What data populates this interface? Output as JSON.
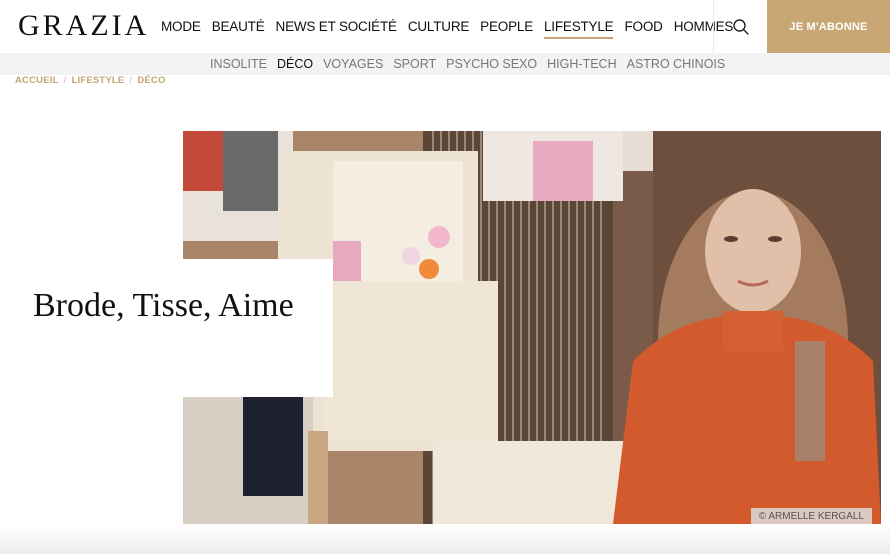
{
  "header": {
    "logo": "GRAZIA",
    "nav": [
      "MODE",
      "BEAUTÉ",
      "NEWS ET SOCIÉTÉ",
      "CULTURE",
      "PEOPLE",
      "LIFESTYLE",
      "FOOD",
      "HOMMES"
    ],
    "active_nav": "LIFESTYLE",
    "search_icon": "search-icon",
    "subscribe_label": "JE M'ABONNE",
    "accent_color": "#c9a775"
  },
  "subnav": {
    "items": [
      "INSOLITE",
      "DÉCO",
      "VOYAGES",
      "SPORT",
      "PSYCHO SEXO",
      "HIGH-TECH",
      "ASTRO CHINOIS"
    ],
    "active": "DÉCO"
  },
  "breadcrumb": [
    "ACCUEIL",
    "LIFESTYLE",
    "DÉCO"
  ],
  "article": {
    "title": "Brode, Tisse, Aime",
    "photo_credit": "© ARMELLE KERGALL"
  }
}
